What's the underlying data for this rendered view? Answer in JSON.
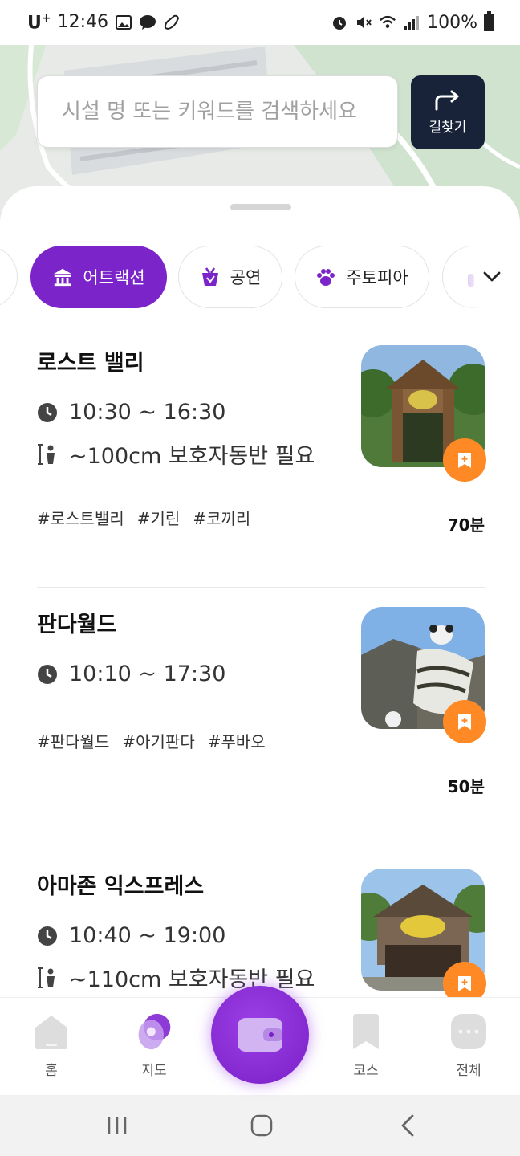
{
  "status_bar": {
    "carrier": "U",
    "carrier_sup": "+",
    "time": "12:46",
    "battery": "100%"
  },
  "search": {
    "placeholder": "시설 명 또는 키워드를 검색하세요"
  },
  "route_button": {
    "label": "길찾기",
    "icon": "turn-right-arrow-icon"
  },
  "categories": [
    {
      "label": "어트랙션",
      "icon": "carousel-icon",
      "active": true
    },
    {
      "label": "공연",
      "icon": "theater-icon",
      "active": false
    },
    {
      "label": "주토피아",
      "icon": "paw-icon",
      "active": false
    }
  ],
  "attractions": [
    {
      "title": "로스트 밸리",
      "hours": "10:30 ~ 16:30",
      "restriction": "~100cm 보호자동반 필요",
      "tags": [
        "#로스트밸리",
        "#기린",
        "#코끼리"
      ],
      "duration": "70분"
    },
    {
      "title": "판다월드",
      "hours": "10:10 ~ 17:30",
      "tags": [
        "#판다월드",
        "#아기판다",
        "#푸바오"
      ],
      "duration": "50분"
    },
    {
      "title": "아마존 익스프레스",
      "hours": "10:40 ~ 19:00",
      "restriction": "~110cm 보호자동반 필요",
      "tags": [],
      "duration": ""
    }
  ],
  "bottom_nav": [
    {
      "label": "홈",
      "icon": "home-icon"
    },
    {
      "label": "지도",
      "icon": "map-pin-icon"
    },
    {
      "label": "",
      "icon": "wallet-icon"
    },
    {
      "label": "코스",
      "icon": "bookmark-icon"
    },
    {
      "label": "전체",
      "icon": "more-icon"
    }
  ],
  "colors": {
    "accent": "#7b24c9",
    "bookmark": "#ff8a25",
    "route_button": "#18233a"
  }
}
